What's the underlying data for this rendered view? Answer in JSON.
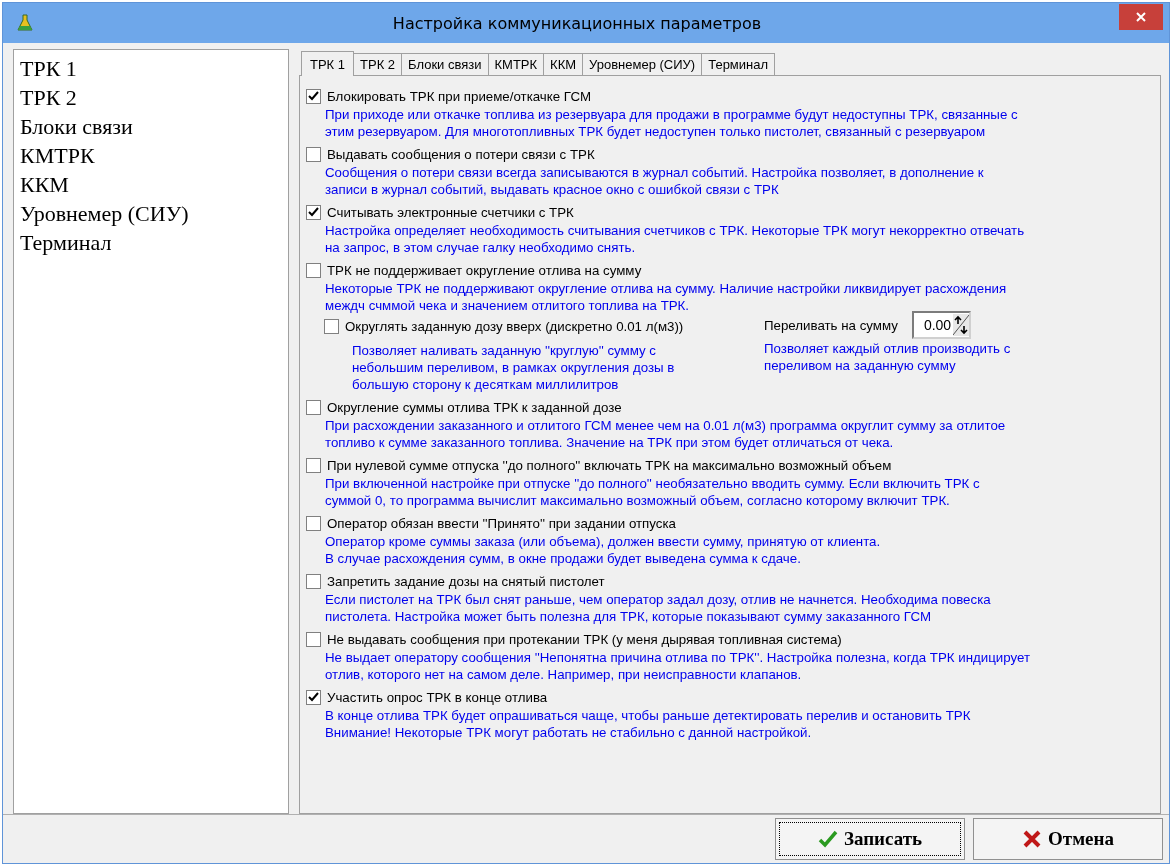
{
  "window": {
    "title": "Настройка коммуникационных параметров"
  },
  "sidebar": {
    "items": [
      {
        "label": "ТРК 1",
        "selected": false
      },
      {
        "label": "ТРК 2",
        "selected": false
      },
      {
        "label": "Блоки связи",
        "selected": false
      },
      {
        "label": "КМТРК",
        "selected": false
      },
      {
        "label": "ККМ",
        "selected": false
      },
      {
        "label": "Уровнемер (СИУ)",
        "selected": false
      },
      {
        "label": "Терминал",
        "selected": false
      }
    ]
  },
  "tabs": [
    {
      "label": "ТРК 1",
      "selected": true
    },
    {
      "label": "ТРК 2",
      "selected": false
    },
    {
      "label": "Блоки связи",
      "selected": false
    },
    {
      "label": "КМТРК",
      "selected": false
    },
    {
      "label": "ККМ",
      "selected": false
    },
    {
      "label": "Уровнемер (СИУ)",
      "selected": false
    },
    {
      "label": "Терминал",
      "selected": false
    }
  ],
  "options": [
    {
      "label": "Блокировать ТРК при приеме/откачке ГСМ",
      "checked": true,
      "description": [
        "При приходе или откачке топлива из резервуара для продажи в программе будут недоступны ТРК, связанные с",
        "этим резервуаром. Для многотопливных ТРК будет недоступен только пистолет, связанный с резервуаром"
      ]
    },
    {
      "label": "Выдавать сообщения о потери связи с ТРК",
      "checked": false,
      "description": [
        "Сообщения о потери связи всегда записываются в журнал событий. Настройка позволяет, в дополнение к",
        "записи в журнал событий, выдавать красное окно с ошибкой связи с ТРК"
      ]
    },
    {
      "label": "Считывать электронные счетчики с ТРК",
      "checked": true,
      "description": [
        "Настройка определяет необходимость считывания счетчиков с ТРК. Некоторые ТРК могут некорректно отвечать",
        "на запрос, в этом случае галку необходимо снять."
      ]
    },
    {
      "label": "ТРК не поддерживает округление отлива на сумму",
      "checked": false,
      "description": [
        "Некоторые ТРК не поддерживают округление отлива на сумму. Наличие настройки ликвидирует расхождения",
        "междч счммой чека и значением отлитого топлива на ТРК."
      ],
      "sub_option": {
        "label": "Округлять заданную дозу вверх (дискретно 0.01 л(м3))",
        "checked": false,
        "description": [
          "Позволяет наливать заданную ''круглую'' сумму с",
          "небольшим переливом, в рамках округления дозы в",
          "большую сторону к десяткам миллилитров"
        ]
      },
      "overflow": {
        "label": "Переливать на сумму",
        "value": "0.00",
        "description": [
          "Позволяет каждый отлив производить с",
          "переливом на заданную сумму"
        ]
      }
    },
    {
      "label": "Округление суммы отлива ТРК к заданной дозе",
      "checked": false,
      "description": [
        "При расхождении заказанного и отлитого ГСМ менее чем на 0.01 л(м3) программа округлит сумму за отлитое",
        "топливо к сумме заказанного топлива. Значение на ТРК при этом будет отличаться от чека."
      ]
    },
    {
      "label": "При нулевой сумме отпуска ''до полного'' включать ТРК на максимально возможный объем",
      "checked": false,
      "description": [
        "При включенной настройке при отпуске ''до полного'' необязательно вводить сумму. Если включить ТРК с",
        "суммой 0, то программа вычислит максимально возможный объем, согласно которому включит ТРК."
      ]
    },
    {
      "label": "Оператор обязан ввести ''Принято'' при задании отпуска",
      "checked": false,
      "description": [
        "Оператор кроме суммы заказа (или объема), должен ввести сумму, принятую от клиента.",
        "В случае расхождения сумм, в окне продажи будет выведена сумма к сдаче."
      ]
    },
    {
      "label": "Запретить задание дозы на снятый пистолет",
      "checked": false,
      "description": [
        "Если пистолет на ТРК был снят раньше, чем оператор задал дозу, отлив не начнется. Необходима повеска",
        "пистолета. Настройка может быть полезна для ТРК, которые показывают сумму заказанного ГСМ"
      ]
    },
    {
      "label": "Не выдавать сообщения при протекании ТРК (у меня дырявая топливная система)",
      "checked": false,
      "description": [
        "Не выдает оператору сообщения ''Непонятна причина отлива по ТРК''. Настройка полезна, когда ТРК индицирует",
        "отлив, которого нет на самом деле. Например, при неисправности клапанов."
      ]
    },
    {
      "label": "Участить опрос ТРК в конце отлива",
      "checked": true,
      "description": [
        "В конце отлива ТРК будет опрашиваться чаще, чтобы раньше детектировать перелив и остановить ТРК",
        "Внимание! Некоторые ТРК могут работать не стабильно с данной настройкой."
      ]
    }
  ],
  "buttons": [
    {
      "label": "Записать",
      "kind": "save"
    },
    {
      "label": "Отмена",
      "kind": "cancel"
    }
  ]
}
